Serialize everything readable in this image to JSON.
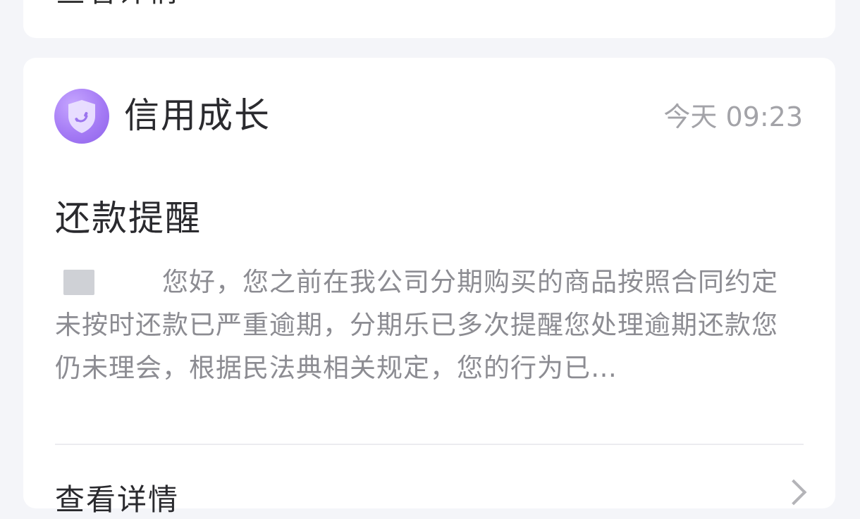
{
  "top_card": {
    "link_label": "查看详情"
  },
  "message": {
    "sender": "信用成长",
    "time": "今天 09:23",
    "title": "还款提醒",
    "body": "您好，您之前在我公司分期购买的商品按照合同约定未按时还款已严重逾期，分期乐已多次提醒您处理逾期还款您仍未理会，根据民法典相关规定，您的行为已…",
    "avatar_icon": "shield-phone-icon",
    "accent_color": "#a57bf5",
    "divider_color": "#ececf0"
  },
  "footer": {
    "detail_label": "查看详情",
    "chevron_icon": "chevron-right-icon"
  }
}
